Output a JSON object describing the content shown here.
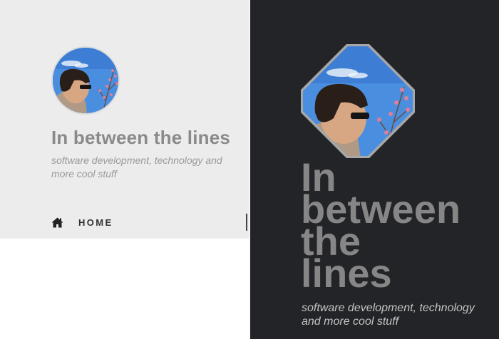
{
  "site": {
    "title": "In between the lines",
    "tagline": "software development, technology and more cool stuff",
    "title_words": [
      "In",
      "between",
      "the",
      "lines"
    ]
  },
  "nav": {
    "items": [
      {
        "label": "HOME",
        "icon": "home-icon"
      }
    ]
  },
  "avatar": {
    "icon": "profile-photo"
  },
  "colors": {
    "left_background": "#ececec",
    "right_background": "#232428",
    "title_gray": "#8a8a8a",
    "nav_text": "#333333"
  }
}
